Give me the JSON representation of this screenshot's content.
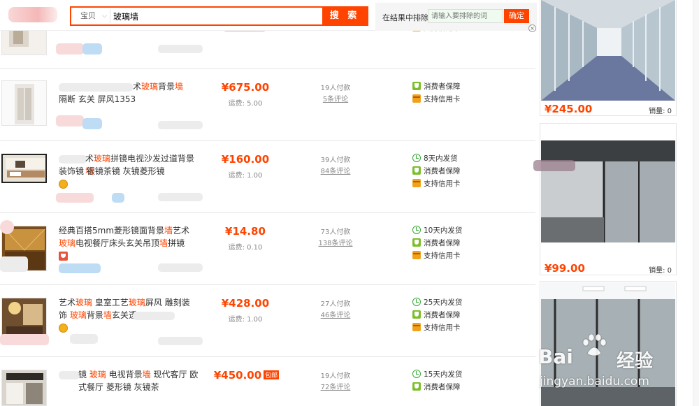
{
  "search": {
    "type_label": "宝贝",
    "query": "玻璃墙",
    "button_label": "搜 索",
    "exclude_label": "在结果中排除",
    "exclude_placeholder": "请输入要排除的词",
    "exclude_confirm": "确定"
  },
  "items": [
    {
      "title_parts": [
        {
          "t": "术"
        },
        {
          "t": "玻璃",
          "h": true
        },
        {
          "t": "背景"
        },
        {
          "t": "墙",
          "h": true
        },
        {
          "t": " 隔断 玄关 屏风1353"
        }
      ],
      "price": "¥675.00",
      "shipping": "运费: 5.00",
      "paid": "19人付款",
      "reviews": "5条评论",
      "services": [
        {
          "icon": "shield-icon",
          "label": "消费者保障"
        },
        {
          "icon": "credit-card-icon",
          "label": "支持信用卡"
        }
      ]
    },
    {
      "title_parts": [
        {
          "t": "术"
        },
        {
          "t": "玻璃",
          "h": true
        },
        {
          "t": "拼镜电视沙发过道背景"
        },
        {
          "t": "墙",
          "h": true
        },
        {
          "t": " 装饰镜 银镜茶镜 灰镜菱形镜"
        }
      ],
      "price": "¥160.00",
      "shipping": "运费: 1.00",
      "paid": "39人付款",
      "reviews": "84条评论",
      "services": [
        {
          "icon": "clock-icon",
          "label": "8天内发货"
        },
        {
          "icon": "shield-icon",
          "label": "消费者保障"
        },
        {
          "icon": "credit-card-icon",
          "label": "支持信用卡"
        }
      ]
    },
    {
      "title_parts": [
        {
          "t": "经典百搭5mm菱形镜面背景"
        },
        {
          "t": "墙",
          "h": true
        },
        {
          "t": "艺术"
        },
        {
          "t": "玻",
          "h": true
        },
        {
          "t": "璃",
          "h": true
        },
        {
          "t": "电视餐厅床头玄关吊顶"
        },
        {
          "t": "墙",
          "h": true
        },
        {
          "t": "拼镜"
        }
      ],
      "price": "¥14.80",
      "shipping": "运费: 0.10",
      "paid": "73人付款",
      "reviews": "138条评论",
      "services": [
        {
          "icon": "clock-icon",
          "label": "10天内发货"
        },
        {
          "icon": "shield-icon",
          "label": "消费者保障"
        },
        {
          "icon": "credit-card-icon",
          "label": "支持信用卡"
        }
      ]
    },
    {
      "title_parts": [
        {
          "t": "艺术"
        },
        {
          "t": "玻璃",
          "h": true
        },
        {
          "t": " 皇室工艺"
        },
        {
          "t": "玻璃",
          "h": true
        },
        {
          "t": "屏风 雕刻装饰 "
        },
        {
          "t": "玻璃",
          "h": true
        },
        {
          "t": "背景"
        },
        {
          "t": "墙",
          "h": true
        },
        {
          "t": "玄关透"
        }
      ],
      "price": "¥428.00",
      "shipping": "运费: 1.00",
      "paid": "27人付款",
      "reviews": "46条评论",
      "services": [
        {
          "icon": "clock-icon",
          "label": "25天内发货"
        },
        {
          "icon": "shield-icon",
          "label": "消费者保障"
        },
        {
          "icon": "credit-card-icon",
          "label": "支持信用卡"
        }
      ]
    },
    {
      "title_parts": [
        {
          "t": "镜 "
        },
        {
          "t": "玻璃",
          "h": true
        },
        {
          "t": " 电视背景"
        },
        {
          "t": "墙",
          "h": true
        },
        {
          "t": " 现代客厅 欧式餐厅 菱形镜 灰镜茶"
        }
      ],
      "price": "¥450.00",
      "price_tag": "包邮",
      "paid": "19人付款",
      "reviews": "72条评论",
      "services": [
        {
          "icon": "clock-icon",
          "label": "15天内发货"
        },
        {
          "icon": "shield-icon",
          "label": "消费者保障"
        }
      ]
    }
  ],
  "top_partial": {
    "services": [
      {
        "icon": "credit-card-icon",
        "label": "支持信用卡"
      }
    ]
  },
  "side_items": [
    {
      "price": "¥245.00",
      "sales": "销量: 0"
    },
    {
      "price": "¥99.00",
      "sales": "销量: 0"
    },
    {
      "price": "",
      "sales": ""
    }
  ],
  "watermark": {
    "brand_left": "Bai",
    "brand_right": "经验",
    "url": "jingyan.baidu.com"
  },
  "colors": {
    "accent": "#ff4400",
    "border": "#e6e6e6"
  }
}
